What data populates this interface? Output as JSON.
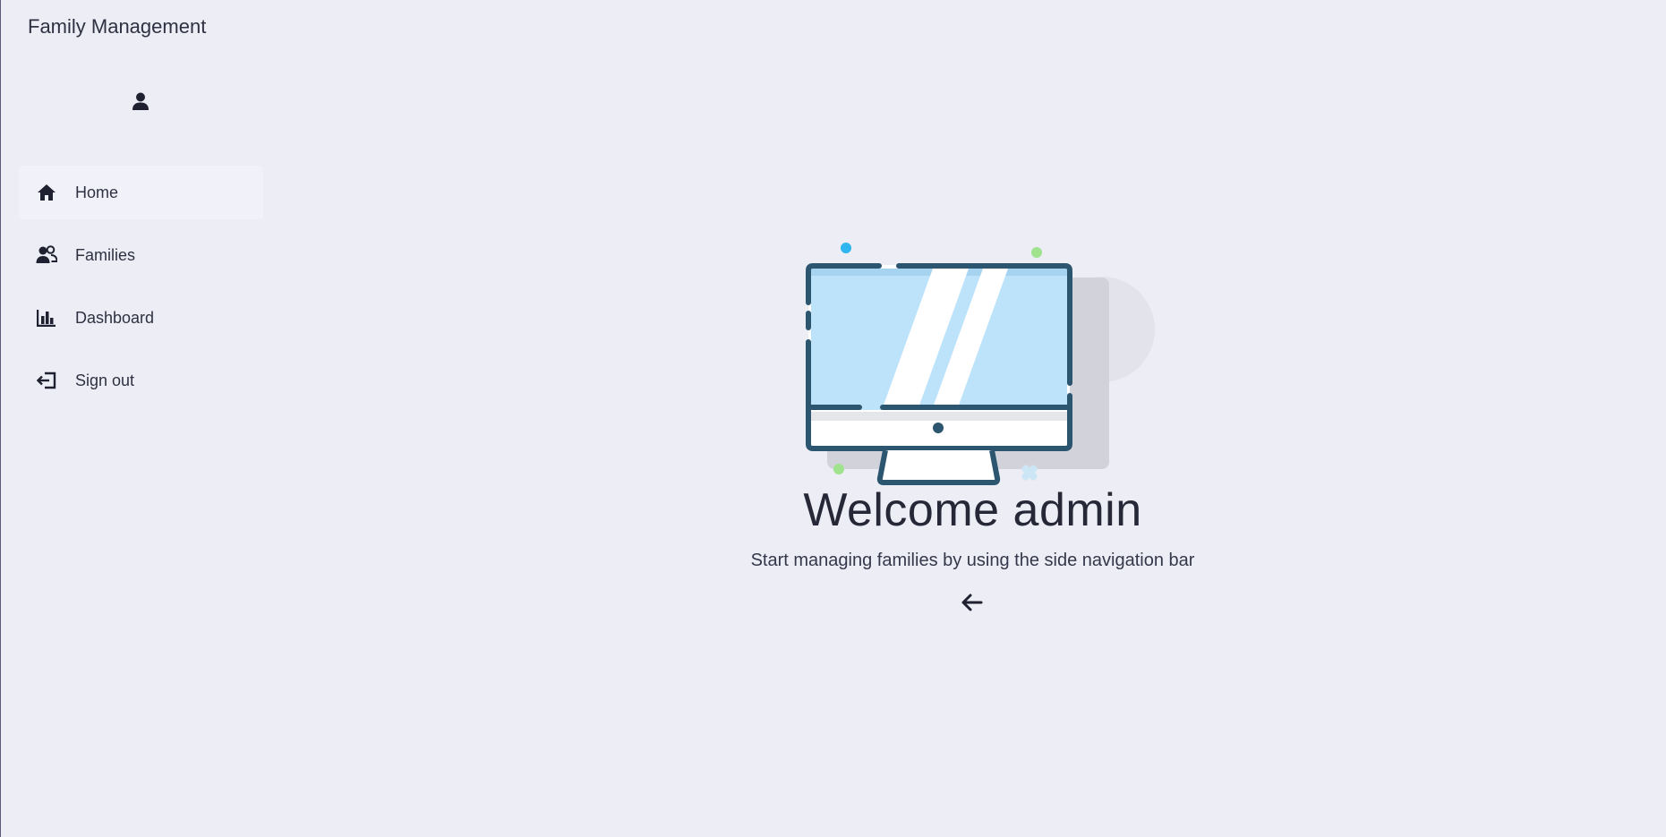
{
  "app": {
    "title": "Family Management"
  },
  "sidebar": {
    "avatar_icon": "user-icon",
    "items": [
      {
        "label": "Home",
        "icon": "home-icon",
        "active": true
      },
      {
        "label": "Families",
        "icon": "users-icon",
        "active": false
      },
      {
        "label": "Dashboard",
        "icon": "chart-bar-icon",
        "active": false
      },
      {
        "label": "Sign out",
        "icon": "sign-out-icon",
        "active": false
      }
    ]
  },
  "main": {
    "illustration": "computer-monitor-illustration",
    "heading": "Welcome admin",
    "subtitle": "Start managing families by using the side navigation bar",
    "back_icon": "arrow-left-icon"
  },
  "colors": {
    "background": "#ecedf5",
    "active_nav": "#f1f2f9",
    "monitor_outline": "#2c5570",
    "monitor_screen": "#bde3fb",
    "accent_blue": "#2fb5f0",
    "accent_green": "#9fe38f"
  }
}
